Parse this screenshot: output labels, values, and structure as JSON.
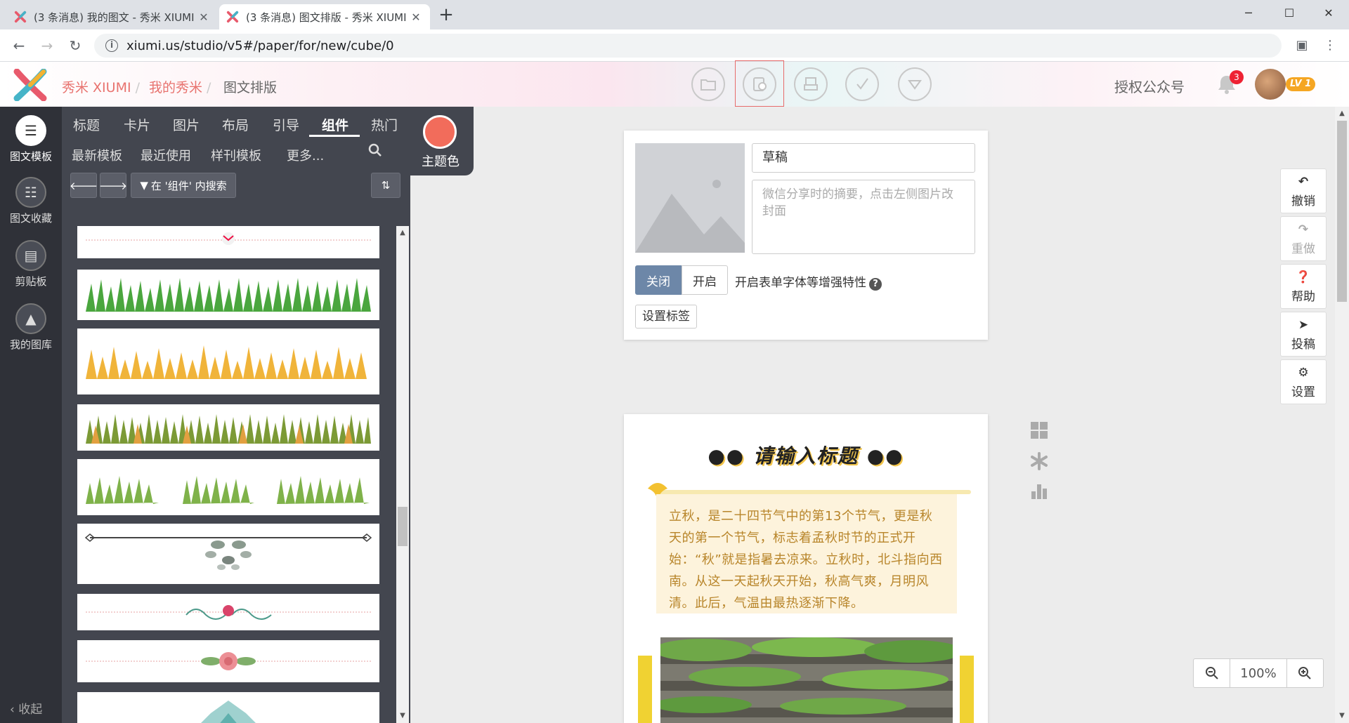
{
  "browser": {
    "tabs": [
      {
        "title": "(3 条消息) 我的图文 - 秀米 XIUMI",
        "active": false
      },
      {
        "title": "(3 条消息) 图文排版 - 秀米 XIUMI",
        "active": true
      }
    ],
    "new_tab": "+",
    "address": "xiumi.us/studio/v5#/paper/for/new/cube/0",
    "controls": {
      "minimize": "─",
      "maximize": "☐",
      "close": "✕"
    }
  },
  "header": {
    "breadcrumb": [
      "秀米 XIUMI",
      "我的秀米",
      "图文排版"
    ],
    "tool_icons": [
      "folder-icon",
      "preview-icon",
      "print-icon",
      "check-icon",
      "dropdown-icon"
    ],
    "selected_tool_label": "预览",
    "authorize": "授权公众号",
    "notification_count": "3",
    "level": "LV 1"
  },
  "rail": {
    "items": [
      {
        "label": "图文模板",
        "icon": "list-icon"
      },
      {
        "label": "图文收藏",
        "icon": "favorite-icon"
      },
      {
        "label": "剪贴板",
        "icon": "clipboard-icon"
      },
      {
        "label": "我的图库",
        "icon": "gallery-icon"
      }
    ],
    "collapse": "收起"
  },
  "panel": {
    "tabs": [
      "标题",
      "卡片",
      "图片",
      "布局",
      "引导",
      "组件",
      "热门"
    ],
    "active_tab": "组件",
    "subtabs": [
      "最新模板",
      "最近使用",
      "样刊模板",
      "更多..."
    ],
    "theme_label": "主题色",
    "theme_color": "#f26c5b",
    "search_scope": "在 '组件' 内搜索"
  },
  "doc": {
    "title_value": "草稿",
    "summary_placeholder": "微信分享时的摘要，点击左侧图片改封面",
    "toggle_off": "关闭",
    "toggle_on": "开启",
    "toggle_label": "开启表单字体等增强特性",
    "tag_button": "设置标签"
  },
  "article": {
    "title": "请输入标题",
    "body": "立秋，是二十四节气中的第13个节气，更是秋天的第一个节气，标志着孟秋时节的正式开始：“秋”就是指暑去凉来。立秋时，北斗指向西南。从这一天起秋天开始，秋高气爽，月明风清。此后，气温由最热逐渐下降。"
  },
  "right_tools": [
    {
      "label": "撤销",
      "icon": "undo-icon"
    },
    {
      "label": "重做",
      "icon": "redo-icon"
    },
    {
      "label": "帮助",
      "icon": "help-icon"
    },
    {
      "label": "投稿",
      "icon": "send-icon"
    },
    {
      "label": "设置",
      "icon": "gear-icon"
    }
  ],
  "zoom": {
    "value": "100%"
  },
  "colors": {
    "brand": "#e8736f",
    "panel_bg": "#43464f",
    "rail_bg": "#2f3138",
    "accent_text": "#b8852a"
  }
}
